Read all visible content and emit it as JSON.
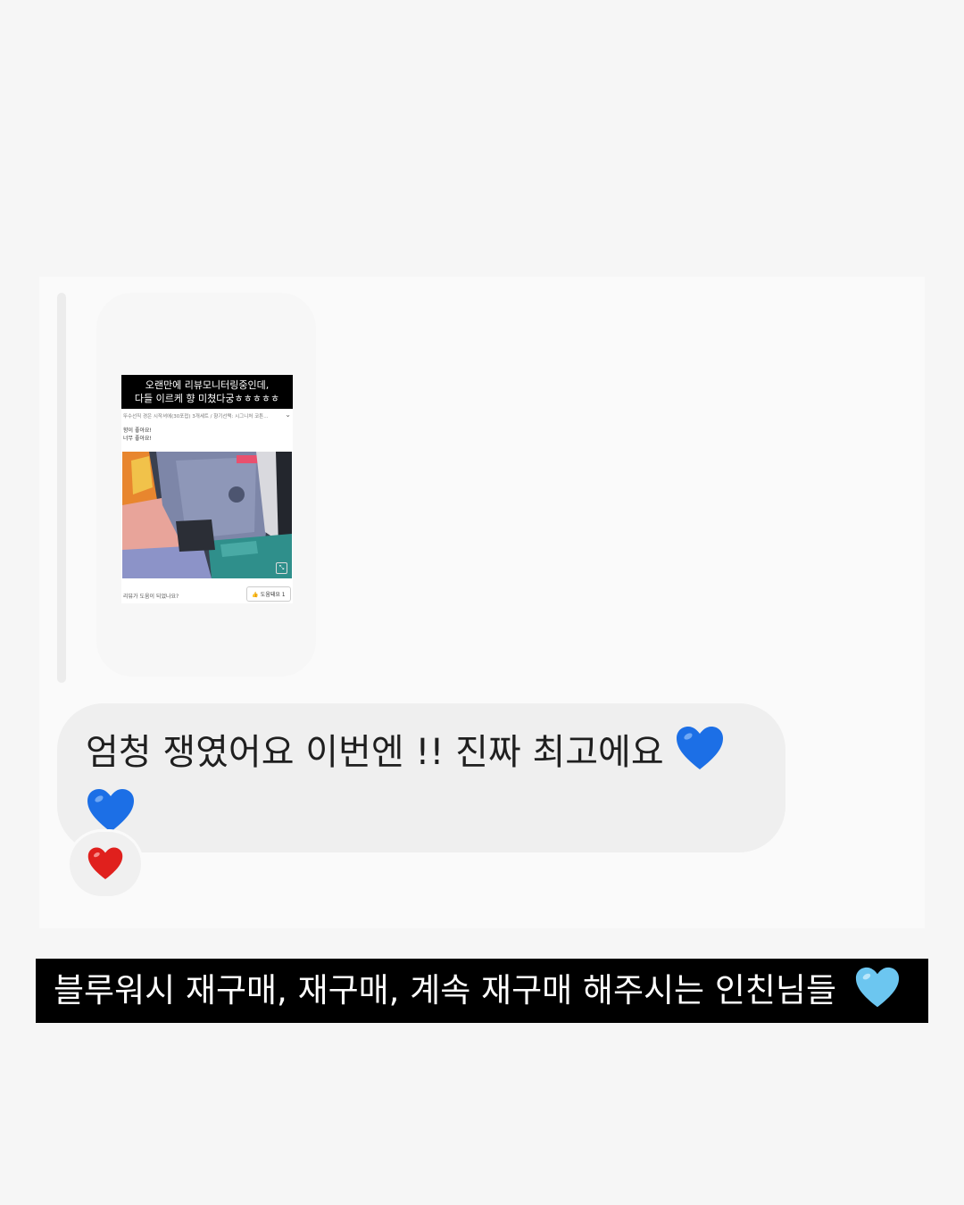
{
  "shared_review": {
    "banner_line1": "오랜만에 리뷰모니터링중인데,",
    "banner_line2": "다들 이르케 향 미쳤다궁ㅎㅎㅎㅎㅎ",
    "product_line": "뚜수선직 경은 시작셔에(30포접) 3개세트 / 향기선택: 시그니처 코튼...",
    "review_line1": "향이 좋아요!",
    "review_line2": "너무 좋아요!",
    "helpful_question": "리뷰가 도움이 되었나요?",
    "helpful_button": "도움돼요 1"
  },
  "message": {
    "text": "엄청 쟁였어요 이번엔 !! 진짜 최고에요",
    "emoji": "blue-heart-icon",
    "emoji_count": 2,
    "reaction": "red-heart-icon"
  },
  "caption": {
    "text": "블루워시 재구매, 재구매, 계속 재구매 해주시는 인친님들",
    "emoji": "light-blue-heart-icon"
  },
  "colors": {
    "background": "#f6f6f6",
    "bubble": "#efefef",
    "caption_bg": "#000000",
    "blue_heart": "#1c6fe6",
    "light_blue_heart": "#6cc6f0",
    "red_heart": "#e0201d"
  }
}
